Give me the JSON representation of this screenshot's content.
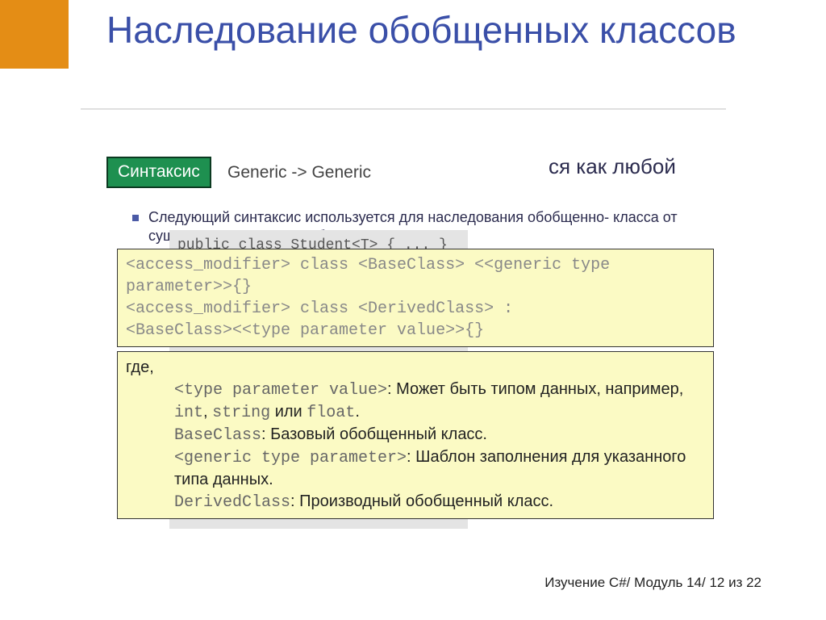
{
  "title": "Наследование обобщенных классов",
  "background": {
    "bullet1_before": "",
    "bullet1_after_tail": "ся как любой",
    "sub1": "Следующий синтаксис используется для наследования обобщенно-\nкласса от существующего класса обощенного класса.",
    "bullet_marker_text": "",
    "code_bg_text": "public class Student<T>\n{\n ...\n}\n\npublic class Derived : Student<int>\n{\n}"
  },
  "badge": "Синтаксис",
  "tab": "Generic -> Generic",
  "codebox": "<access_modifier> class <BaseClass> <<generic type\nparameter>>{}\n<access_modifier> class <DerivedClass> :\n<BaseClass><<type parameter value>>{}",
  "def": {
    "where": "где,",
    "r1a": "<type parameter value>",
    "r1b": ": Может быть типом данных, например, ",
    "r1c": "int",
    "r1d": ", ",
    "r1e": "string",
    "r1f": " или ",
    "r1g": "float",
    "r1h": ".",
    "r2a": "BaseClass",
    "r2b": ":  Базовый обобщенный класс.",
    "r3a": "<generic type parameter>",
    "r3b": ":  Шаблон заполнения для указанного типа данных.",
    "r4a": "DerivedClass",
    "r4b": ":  Производный обобщенный класс."
  },
  "footer": "Изучение C#/ Модуль 14/ 12 из 22"
}
